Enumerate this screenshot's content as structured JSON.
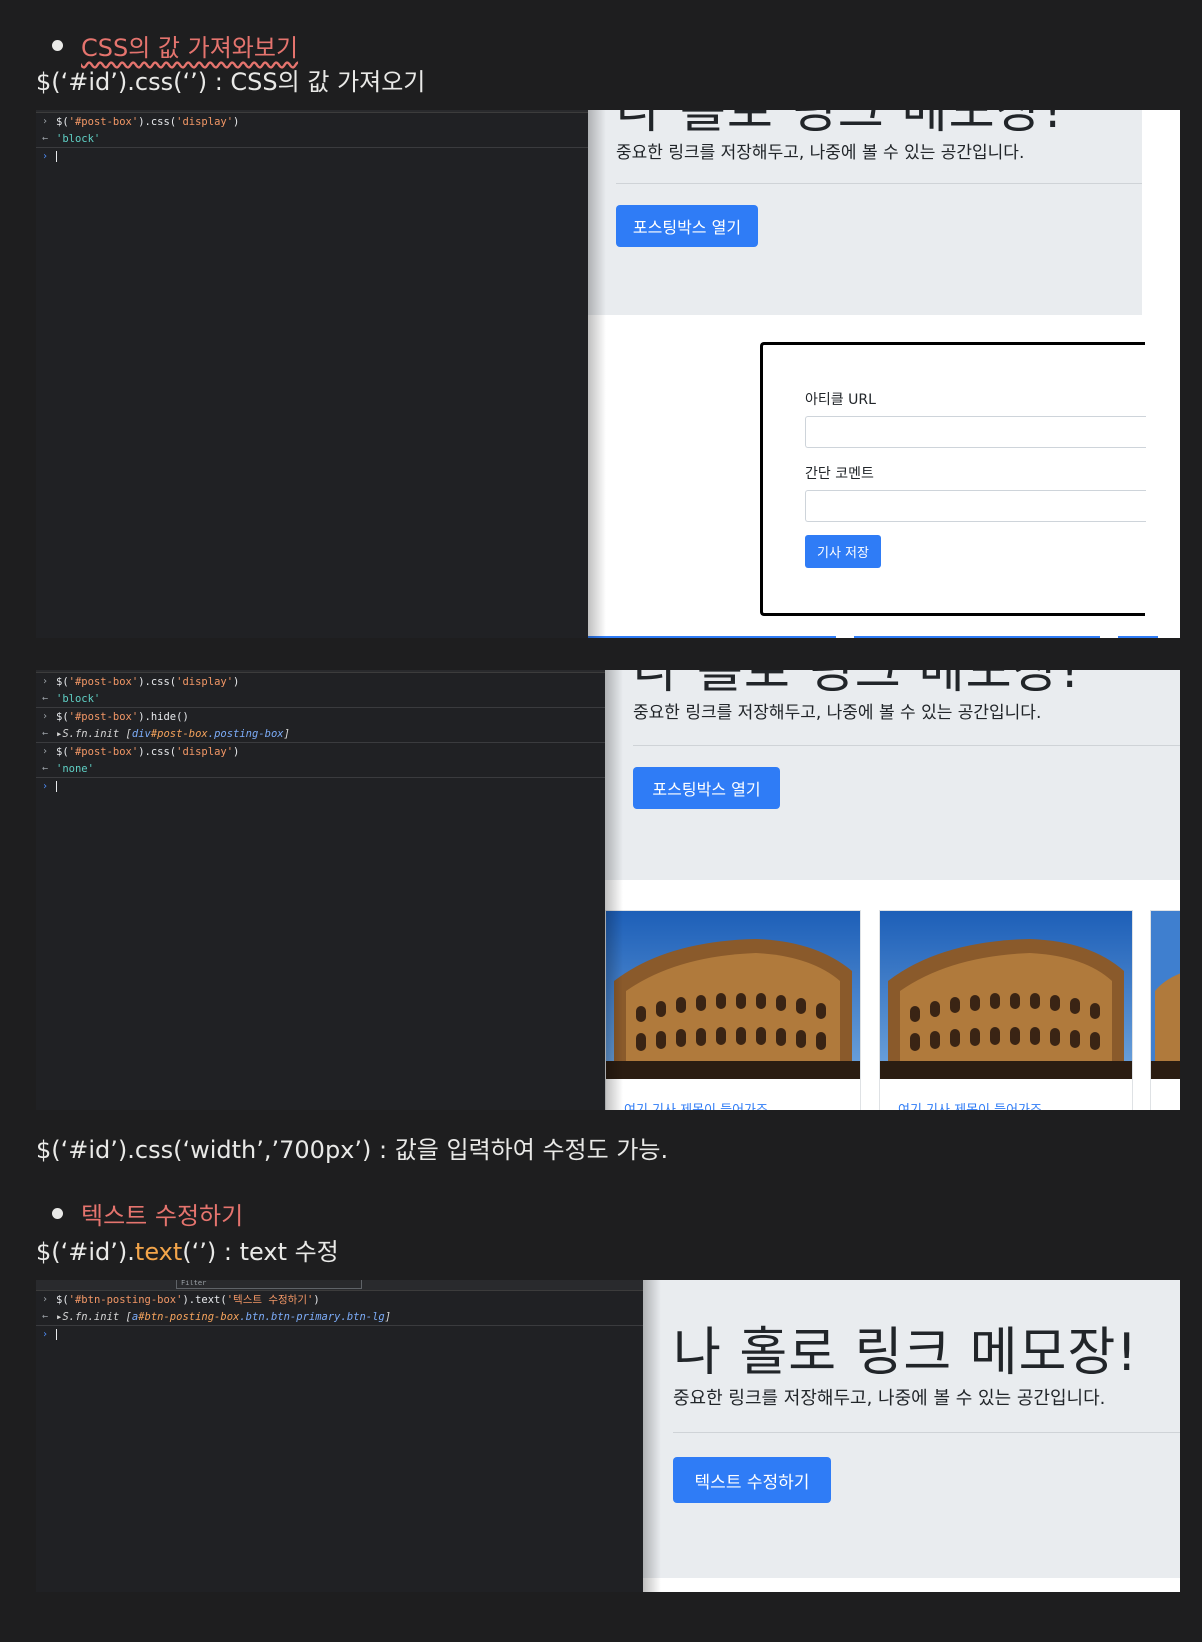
{
  "section1": {
    "bullet": "CSS의 값 가져와보기",
    "heading": "$(‘#id’).css(‘’) : CSS의 값 가져오기",
    "console": {
      "lines": [
        {
          "code_pre": "$(",
          "str1": "'#post-box'",
          "code_mid": ").css(",
          "str2": "'display'",
          "code_post": ")"
        },
        {
          "result": "'block'"
        }
      ]
    },
    "page": {
      "desc": "중요한 링크를 저장해두고, 나중에 볼 수 있는 공간입니다.",
      "open_button": "포스팅박스 열기",
      "form": {
        "url_label": "아티클 URL",
        "comment_label": "간단 코멘트",
        "save_button": "기사 저장"
      }
    }
  },
  "section2": {
    "console": {
      "l1": {
        "code_pre": "$(",
        "str1": "'#post-box'",
        "code_mid": ").css(",
        "str2": "'display'",
        "code_post": ")"
      },
      "r1": "'block'",
      "l2": {
        "code_pre": "$(",
        "str1": "'#post-box'",
        "code_post": ").hide()"
      },
      "r2": {
        "pre": "S.fn.init [",
        "tag": "div",
        "id": "#post-box",
        "cls": ".posting-box",
        "post": "]"
      },
      "l3": {
        "code_pre": "$(",
        "str1": "'#post-box'",
        "code_mid": ").css(",
        "str2": "'display'",
        "code_post": ")"
      },
      "r3": "'none'"
    },
    "page": {
      "desc": "중요한 링크를 저장해두고, 나중에 볼 수 있는 공간입니다.",
      "open_button": "포스팅박스 열기",
      "card_title": "여기 기사 제목이 들어가죠"
    },
    "note": "$(‘#id’).css(‘width’,’700px’) : 값을 입력하여 수정도 가능."
  },
  "section3": {
    "bullet": "텍스트 수정하기",
    "heading_pre": "$(‘#id’).",
    "heading_hl": "text",
    "heading_post": "(‘’) : text 수정",
    "console": {
      "filter_placeholder": "Filter",
      "l1": {
        "code_pre": "$(",
        "str1": "'#btn-posting-box'",
        "code_mid": ").text(",
        "str2": "'텍스트 수정하기'",
        "code_post": ")"
      },
      "r1": {
        "pre": "S.fn.init [",
        "tag": "a",
        "id": "#btn-posting-box",
        "cls": ".btn.btn-primary.btn-lg",
        "post": "]"
      }
    },
    "page": {
      "title": "나 홀로 링크 메모장!",
      "desc": "중요한 링크를 저장해두고, 나중에 볼 수 있는 공간입니다.",
      "button": "텍스트 수정하기"
    }
  },
  "colors": {
    "accent_red": "#e5746e",
    "accent_orange": "#f3a54a",
    "bootstrap_primary": "#2f7cf6"
  }
}
